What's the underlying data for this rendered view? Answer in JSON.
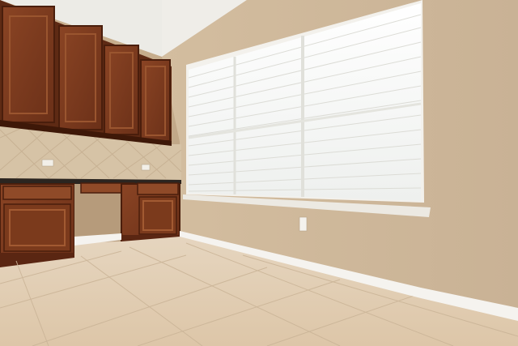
{
  "scene": {
    "description_colors": {
      "wall": "#cfb99d",
      "ceiling": "#eeece6",
      "cabinet": "#7a3a1e",
      "cabinet_dark": "#5a2612",
      "countertop": "#2a2622",
      "tile_backsplash": "#d8c6aa",
      "floor_tile": "#e2cfb6",
      "baseboard": "#f4f2ee",
      "blinds": "#f7f7f5"
    }
  }
}
